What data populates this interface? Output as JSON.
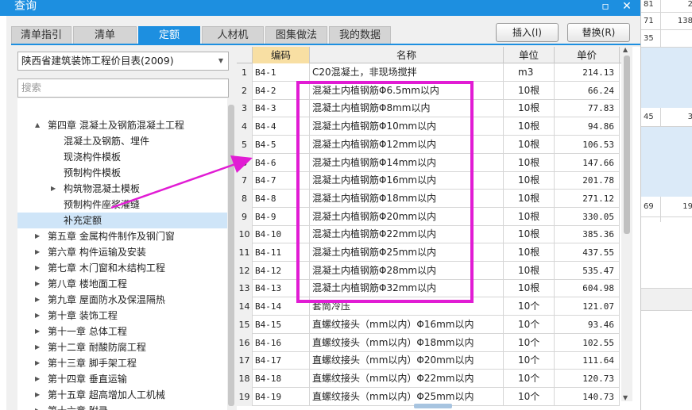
{
  "window": {
    "title": "查询",
    "maximize_icon": "maximize-icon",
    "close_icon": "close-icon",
    "accent_color": "#1d8fe0"
  },
  "tabs": [
    {
      "label": "清单指引",
      "active": false
    },
    {
      "label": "清单",
      "active": false
    },
    {
      "label": "定额",
      "active": true
    },
    {
      "label": "人材机",
      "active": false
    },
    {
      "label": "图集做法",
      "active": false
    },
    {
      "label": "我的数据",
      "active": false
    }
  ],
  "actions": {
    "insert_label": "插入(I)",
    "replace_label": "替换(R)"
  },
  "library_select": {
    "value": "陕西省建筑装饰工程价目表(2009)"
  },
  "search": {
    "placeholder": "搜索"
  },
  "tree": [
    {
      "label": "第四章 混凝土及钢筋混凝土工程",
      "level": 0,
      "expander": "▲",
      "selected": false
    },
    {
      "label": "混凝土及钢筋、埋件",
      "level": 1,
      "expander": "",
      "selected": false
    },
    {
      "label": "现浇构件模板",
      "level": 1,
      "expander": "",
      "selected": false
    },
    {
      "label": "预制构件模板",
      "level": 1,
      "expander": "",
      "selected": false
    },
    {
      "label": "构筑物混凝土模板",
      "level": 1,
      "expander": "▶",
      "selected": false
    },
    {
      "label": "预制构件座浆灌缝",
      "level": 1,
      "expander": "",
      "selected": false
    },
    {
      "label": "补充定额",
      "level": 1,
      "expander": "",
      "selected": true
    },
    {
      "label": "第五章 金属构件制作及钢门窗",
      "level": 0,
      "expander": "▶",
      "selected": false
    },
    {
      "label": "第六章 构件运输及安装",
      "level": 0,
      "expander": "▶",
      "selected": false
    },
    {
      "label": "第七章 木门窗和木结构工程",
      "level": 0,
      "expander": "▶",
      "selected": false
    },
    {
      "label": "第八章 楼地面工程",
      "level": 0,
      "expander": "▶",
      "selected": false
    },
    {
      "label": "第九章 屋面防水及保温隔热",
      "level": 0,
      "expander": "▶",
      "selected": false
    },
    {
      "label": "第十章 装饰工程",
      "level": 0,
      "expander": "▶",
      "selected": false
    },
    {
      "label": "第十一章 总体工程",
      "level": 0,
      "expander": "▶",
      "selected": false
    },
    {
      "label": "第十二章 耐酸防腐工程",
      "level": 0,
      "expander": "▶",
      "selected": false
    },
    {
      "label": "第十三章 脚手架工程",
      "level": 0,
      "expander": "▶",
      "selected": false
    },
    {
      "label": "第十四章 垂直运输",
      "level": 0,
      "expander": "▶",
      "selected": false
    },
    {
      "label": "第十五章 超高增加人工机械",
      "level": 0,
      "expander": "▶",
      "selected": false
    },
    {
      "label": "第十六章 附录",
      "level": 0,
      "expander": "▶",
      "selected": false
    }
  ],
  "grid": {
    "columns": [
      "编码",
      "名称",
      "单位",
      "单价"
    ],
    "rows": [
      {
        "n": "1",
        "code": "B4-1",
        "name": "C20混凝土，非现场搅拌",
        "unit": "m3",
        "price": "214.13"
      },
      {
        "n": "2",
        "code": "B4-2",
        "name": "混凝土内植钢筋Φ6.5mm以内",
        "unit": "10根",
        "price": "66.24"
      },
      {
        "n": "3",
        "code": "B4-3",
        "name": "混凝土内植钢筋Φ8mm以内",
        "unit": "10根",
        "price": "77.83"
      },
      {
        "n": "4",
        "code": "B4-4",
        "name": "混凝土内植钢筋Φ10mm以内",
        "unit": "10根",
        "price": "94.86"
      },
      {
        "n": "5",
        "code": "B4-5",
        "name": "混凝土内植钢筋Φ12mm以内",
        "unit": "10根",
        "price": "106.53"
      },
      {
        "n": "6",
        "code": "B4-6",
        "name": "混凝土内植钢筋Φ14mm以内",
        "unit": "10根",
        "price": "147.66"
      },
      {
        "n": "7",
        "code": "B4-7",
        "name": "混凝土内植钢筋Φ16mm以内",
        "unit": "10根",
        "price": "201.78"
      },
      {
        "n": "8",
        "code": "B4-8",
        "name": "混凝土内植钢筋Φ18mm以内",
        "unit": "10根",
        "price": "271.12"
      },
      {
        "n": "9",
        "code": "B4-9",
        "name": "混凝土内植钢筋Φ20mm以内",
        "unit": "10根",
        "price": "330.05"
      },
      {
        "n": "10",
        "code": "B4-10",
        "name": "混凝土内植钢筋Φ22mm以内",
        "unit": "10根",
        "price": "385.36"
      },
      {
        "n": "11",
        "code": "B4-11",
        "name": "混凝土内植钢筋Φ25mm以内",
        "unit": "10根",
        "price": "437.55"
      },
      {
        "n": "12",
        "code": "B4-12",
        "name": "混凝土内植钢筋Φ28mm以内",
        "unit": "10根",
        "price": "535.47"
      },
      {
        "n": "13",
        "code": "B4-13",
        "name": "混凝土内植钢筋Φ32mm以内",
        "unit": "10根",
        "price": "604.98"
      },
      {
        "n": "14",
        "code": "B4-14",
        "name": "套筒冷压",
        "unit": "10个",
        "price": "121.07"
      },
      {
        "n": "15",
        "code": "B4-15",
        "name": "直螺纹接头（mm以内）Φ16mm以内",
        "unit": "10个",
        "price": "93.46"
      },
      {
        "n": "16",
        "code": "B4-16",
        "name": "直螺纹接头（mm以内）Φ18mm以内",
        "unit": "10个",
        "price": "102.55"
      },
      {
        "n": "17",
        "code": "B4-17",
        "name": "直螺纹接头（mm以内）Φ20mm以内",
        "unit": "10个",
        "price": "111.64"
      },
      {
        "n": "18",
        "code": "B4-18",
        "name": "直螺纹接头（mm以内）Φ22mm以内",
        "unit": "10个",
        "price": "120.73"
      },
      {
        "n": "19",
        "code": "B4-19",
        "name": "直螺纹接头（mm以内）Φ25mm以内",
        "unit": "10个",
        "price": "140.73"
      }
    ]
  },
  "background_sheet": [
    {
      "a": "81",
      "b": "2"
    },
    {
      "a": "71",
      "b": "138"
    },
    {
      "a": "35",
      "b": ""
    },
    {
      "a": "45",
      "b": "3"
    },
    {
      "a": "69",
      "b": "19"
    }
  ],
  "annotation": {
    "box_color": "#e11cd4",
    "arrow_color": "#e11cd4"
  }
}
